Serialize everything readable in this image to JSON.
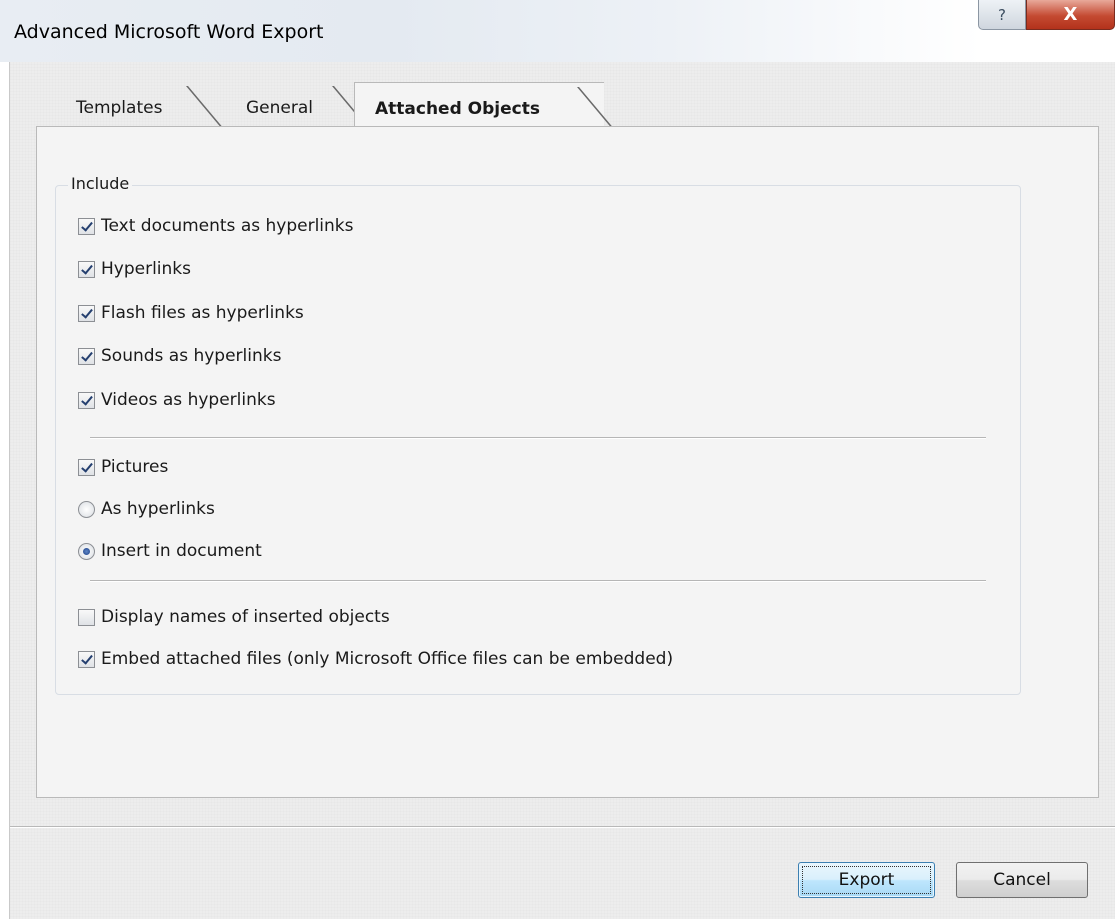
{
  "window": {
    "title": "Advanced Microsoft Word Export",
    "help_glyph": "?",
    "close_glyph": "X"
  },
  "tabs": [
    {
      "label": "Templates",
      "active": false
    },
    {
      "label": "General",
      "active": false
    },
    {
      "label": "Attached Objects",
      "active": true
    }
  ],
  "include_group": {
    "label": "Include",
    "hyperlink_options": [
      {
        "label": "Text documents as hyperlinks",
        "checked": true
      },
      {
        "label": "Hyperlinks",
        "checked": true
      },
      {
        "label": "Flash files as hyperlinks",
        "checked": true
      },
      {
        "label": "Sounds as hyperlinks",
        "checked": true
      },
      {
        "label": "Videos as hyperlinks",
        "checked": true
      }
    ],
    "pictures": {
      "label": "Pictures",
      "checked": true,
      "mode_options": [
        {
          "label": "As hyperlinks",
          "selected": false
        },
        {
          "label": "Insert in document",
          "selected": true
        }
      ]
    },
    "other_options": [
      {
        "label": "Display names of inserted objects",
        "checked": false
      },
      {
        "label": "Embed attached files (only Microsoft Office files can be embedded)",
        "checked": true
      }
    ]
  },
  "buttons": {
    "export_label": "Export",
    "cancel_label": "Cancel"
  }
}
